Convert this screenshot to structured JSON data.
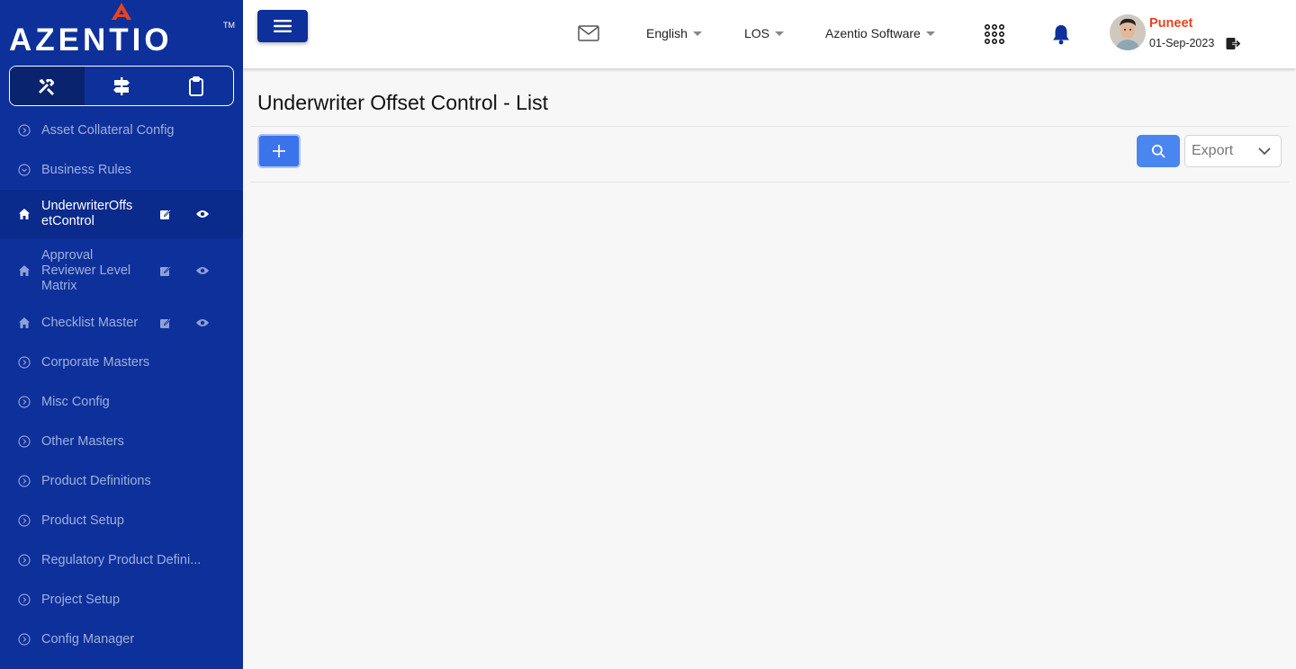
{
  "brand": {
    "logo_text": "AZENTIO",
    "trademark": "TM"
  },
  "sidebar": {
    "tabs": [
      {
        "name": "tools-icon"
      },
      {
        "name": "signpost-icon"
      },
      {
        "name": "clipboard-icon"
      }
    ],
    "items": [
      {
        "label": "Asset Collateral Config",
        "icon": "chevron-circle-icon"
      },
      {
        "label": "Business Rules",
        "icon": "chevron-circle-down-icon"
      },
      {
        "label": "UnderwriterOffsetControl",
        "label_line1": "UnderwriterOffs",
        "label_line2": "etControl",
        "icon": "home-icon",
        "active": true
      },
      {
        "label": "Approval Reviewer Level Matrix",
        "label_line1": "Approval",
        "label_line2": "Reviewer Level",
        "label_line3": "Matrix",
        "icon": "home-icon"
      },
      {
        "label": "Checklist Master",
        "icon": "home-icon"
      },
      {
        "label": "Corporate Masters",
        "icon": "chevron-circle-icon"
      },
      {
        "label": "Misc Config",
        "icon": "chevron-circle-icon"
      },
      {
        "label": "Other Masters",
        "icon": "chevron-circle-icon"
      },
      {
        "label": "Product Definitions",
        "icon": "chevron-circle-icon"
      },
      {
        "label": "Product Setup",
        "icon": "chevron-circle-icon"
      },
      {
        "label": "Regulatory Product Defini...",
        "icon": "chevron-circle-icon"
      },
      {
        "label": "Project Setup",
        "icon": "chevron-circle-icon"
      },
      {
        "label": "Config Manager",
        "icon": "chevron-circle-icon"
      }
    ]
  },
  "header": {
    "language": "English",
    "module": "LOS",
    "company": "Azentio Software",
    "user": {
      "name": "Puneet",
      "date": "01-Sep-2023"
    }
  },
  "main": {
    "title": "Underwriter Offset Control - List",
    "export_label": "Export"
  },
  "colors": {
    "sidebar_bg": "#0e309b",
    "accent": "#3b74ea",
    "user_name": "#e8431f",
    "logo_mark": "#e8431f"
  }
}
